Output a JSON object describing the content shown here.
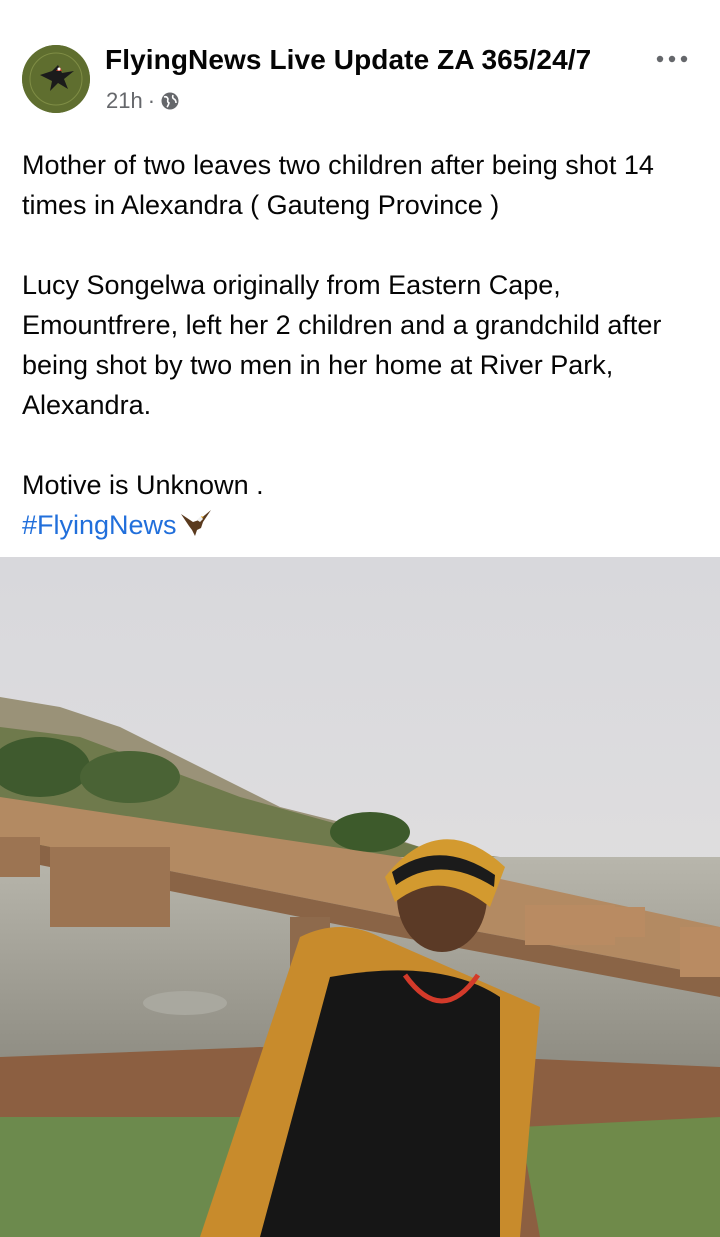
{
  "post": {
    "page_name": "FlyingNews Live Update ZA 365/24/7",
    "timestamp": "21h",
    "separator": "·",
    "audience_icon": "globe-icon",
    "more_icon": "more-options-icon",
    "paragraph1": "Mother of two leaves two children after being shot 14 times in Alexandra ( Gauteng Province )",
    "paragraph2": "Lucy Songelwa originally from Eastern Cape, Emountfrere,  left her 2 children and a grandchild after being shot by two men in her home at River Park, Alexandra.",
    "paragraph3": "Motive is Unknown .",
    "hashtag": "#FlyingNews",
    "hashtag_emoji": "eagle-icon"
  },
  "colors": {
    "text": "#050505",
    "meta": "#65676b",
    "link": "#216fdb",
    "avatar_bg": "#5f6e2f"
  }
}
